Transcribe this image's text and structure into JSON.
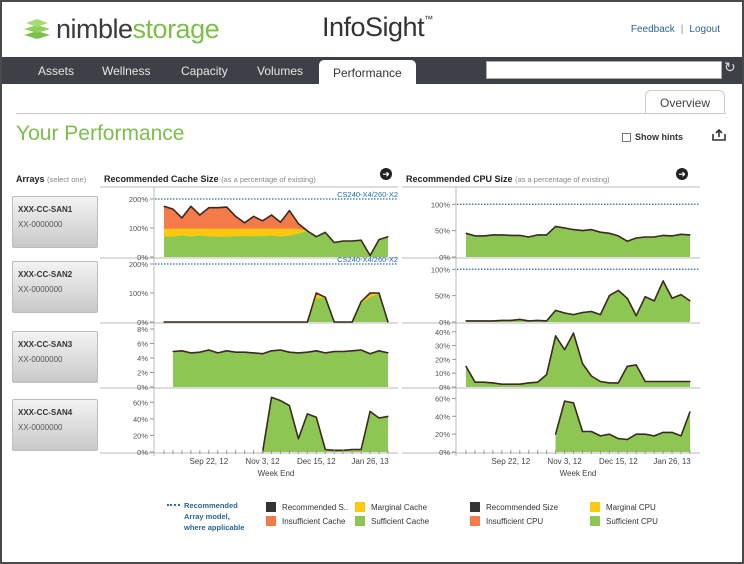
{
  "header": {
    "logo_part1": "nimble",
    "logo_part2": "storage",
    "app_title": "InfoSight",
    "trademark": "™",
    "links": [
      {
        "label": "Feedback"
      },
      {
        "label": "Logout"
      }
    ],
    "link_separator": "|"
  },
  "nav": {
    "tabs": [
      {
        "label": "Assets",
        "active": false
      },
      {
        "label": "Wellness",
        "active": false
      },
      {
        "label": "Capacity",
        "active": false
      },
      {
        "label": "Volumes",
        "active": false
      },
      {
        "label": "Performance",
        "active": true
      }
    ],
    "search": {
      "value": "",
      "placeholder": ""
    },
    "refresh_icon": "refresh-icon"
  },
  "subtabs": {
    "overview_label": "Overview"
  },
  "page": {
    "title": "Your Performance",
    "show_hints_label": "Show hints",
    "show_hints_checked": false,
    "export_icon": "export-icon"
  },
  "arrays": {
    "heading": "Arrays",
    "heading_sub": "(select one)",
    "items": [
      {
        "name": "XXX-CC-SAN1",
        "serial": "XX-0000000"
      },
      {
        "name": "XXX-CC-SAN2",
        "serial": "XX-0000000"
      },
      {
        "name": "XXX-CC-SAN3",
        "serial": "XX-0000000"
      },
      {
        "name": "XXX-CC-SAN4",
        "serial": "XX-0000000"
      }
    ]
  },
  "colors": {
    "sufficient": "#8dc653",
    "marginal": "#fdc80f",
    "insufficient": "#f47a4a",
    "recommended_line": "#3a2a20",
    "recommended_model": "#2a6eb0",
    "brand_green": "#7cc04a",
    "nav_bg": "#3d4046"
  },
  "legend": {
    "recommended_note": [
      "Recommended",
      "Array model,",
      "where applicable"
    ],
    "cache": [
      {
        "label": "Recommended S..",
        "color": "#333333"
      },
      {
        "label": "Marginal Cache",
        "color": "#fdc80f"
      },
      {
        "label": "Insufficient Cache",
        "color": "#f47a4a"
      },
      {
        "label": "Sufficient Cache",
        "color": "#8dc653"
      }
    ],
    "cpu": [
      {
        "label": "Recommended Size",
        "color": "#333333"
      },
      {
        "label": "Marginal CPU",
        "color": "#fdc80f"
      },
      {
        "label": "Insufficient CPU",
        "color": "#f47a4a"
      },
      {
        "label": "Sufficient CPU",
        "color": "#8dc653"
      }
    ]
  },
  "chart_data": [
    {
      "type": "area",
      "title": "Recommended Cache Size",
      "subtitle": "(as a percentage of existing)",
      "xlabel": "Week End",
      "x_ticks": [
        "Sep 22, 12",
        "Nov 3, 12",
        "Dec 15, 12",
        "Jan 26, 13"
      ],
      "x_tick_indices": [
        5,
        11,
        17,
        23
      ],
      "num_weeks": 26,
      "rows": [
        {
          "array": "XXX-CC-SAN1",
          "ylim": [
            0,
            200
          ],
          "yticks": [
            "0%",
            "100%",
            "200%"
          ],
          "ytick_values": [
            0,
            100,
            200
          ],
          "recommended_model": {
            "label": "CS240-X4/260-X2",
            "value": 200
          },
          "series": [
            {
              "name": "Recommended Size",
              "values": [
                175,
                165,
                135,
                175,
                145,
                170,
                170,
                172,
                140,
                118,
                140,
                125,
                145,
                120,
                160,
                115,
                90,
                70,
                85,
                50,
                55,
                55,
                58,
                5,
                60,
                70
              ]
            },
            {
              "name": "Marginal",
              "values": [
                98,
                98,
                98,
                98,
                98,
                98,
                98,
                98,
                98,
                98,
                98,
                98,
                98,
                98,
                98,
                98,
                90,
                70,
                85,
                50,
                55,
                55,
                58,
                5,
                60,
                70
              ]
            },
            {
              "name": "Sufficient",
              "values": [
                70,
                70,
                75,
                70,
                74,
                71,
                70,
                70,
                71,
                72,
                71,
                72,
                74,
                70,
                74,
                80,
                90,
                70,
                85,
                50,
                55,
                55,
                58,
                5,
                60,
                70
              ]
            }
          ]
        },
        {
          "array": "XXX-CC-SAN2",
          "ylim": [
            0,
            200
          ],
          "yticks": [
            "0%",
            "100%",
            "200%"
          ],
          "ytick_values": [
            0,
            100,
            200
          ],
          "recommended_model": {
            "label": "CS240-X4/260-X2",
            "value": 200
          },
          "series": [
            {
              "name": "Recommended Size",
              "values": [
                0,
                0,
                0,
                0,
                0,
                0,
                0,
                0,
                0,
                0,
                0,
                0,
                0,
                0,
                0,
                0,
                0,
                100,
                85,
                0,
                0,
                0,
                70,
                100,
                100,
                0
              ]
            },
            {
              "name": "Marginal",
              "values": [
                0,
                0,
                0,
                0,
                0,
                0,
                0,
                0,
                0,
                0,
                0,
                0,
                0,
                0,
                0,
                0,
                0,
                95,
                85,
                0,
                0,
                0,
                68,
                95,
                100,
                0
              ]
            },
            {
              "name": "Sufficient",
              "values": [
                0,
                0,
                0,
                0,
                0,
                0,
                0,
                0,
                0,
                0,
                0,
                0,
                0,
                0,
                0,
                0,
                0,
                80,
                85,
                0,
                0,
                0,
                65,
                85,
                98,
                0
              ]
            }
          ]
        },
        {
          "array": "XXX-CC-SAN3",
          "ylim": [
            0,
            8
          ],
          "yticks": [
            "0%",
            "2%",
            "4%",
            "6%",
            "8%"
          ],
          "ytick_values": [
            0,
            2,
            4,
            6,
            8
          ],
          "series": [
            {
              "name": "Recommended Size",
              "values": [
                null,
                4.9,
                5,
                4.7,
                4.8,
                5.1,
                4.7,
                5,
                4.8,
                4.8,
                4.7,
                4.6,
                5,
                5.1,
                4.8,
                4.7,
                4.8,
                5,
                4.7,
                4.9,
                4.9,
                5,
                5.1,
                4.6,
                5,
                4.7
              ]
            },
            {
              "name": "Sufficient",
              "values": [
                null,
                4.9,
                5,
                4.7,
                4.8,
                5.1,
                4.7,
                5,
                4.8,
                4.8,
                4.7,
                4.6,
                5,
                5.1,
                4.8,
                4.7,
                4.8,
                5,
                4.7,
                4.9,
                4.9,
                5,
                5.1,
                4.6,
                5,
                4.7
              ]
            }
          ]
        },
        {
          "array": "XXX-CC-SAN4",
          "ylim": [
            0,
            70
          ],
          "yticks": [
            "0%",
            "20%",
            "40%",
            "60%"
          ],
          "ytick_values": [
            0,
            20,
            40,
            60
          ],
          "series": [
            {
              "name": "Recommended Size",
              "values": [
                null,
                null,
                null,
                null,
                null,
                null,
                null,
                null,
                null,
                null,
                null,
                0,
                66,
                62,
                56,
                16,
                46,
                42,
                3,
                2,
                2,
                3,
                3,
                49,
                41,
                43
              ]
            },
            {
              "name": "Sufficient",
              "values": [
                null,
                null,
                null,
                null,
                null,
                null,
                null,
                null,
                null,
                null,
                null,
                0,
                66,
                62,
                56,
                16,
                46,
                42,
                3,
                2,
                2,
                3,
                3,
                49,
                41,
                43
              ]
            }
          ]
        }
      ]
    },
    {
      "type": "area",
      "title": "Recommended CPU Size",
      "subtitle": "(as a percentage of existing)",
      "xlabel": "Week End",
      "x_ticks": [
        "Sep 22, 12",
        "Nov 3, 12",
        "Dec 15, 12",
        "Jan 26, 13"
      ],
      "x_tick_indices": [
        5,
        11,
        17,
        23
      ],
      "num_weeks": 26,
      "rows": [
        {
          "array": "XXX-CC-SAN1",
          "ylim": [
            0,
            110
          ],
          "yticks": [
            "0%",
            "50%",
            "100%"
          ],
          "ytick_values": [
            0,
            50,
            100
          ],
          "recommended_model": {
            "label": "",
            "value": 100
          },
          "series": [
            {
              "name": "Recommended Size",
              "values": [
                45,
                40,
                40,
                42,
                42,
                41,
                41,
                38,
                42,
                42,
                58,
                55,
                52,
                50,
                52,
                47,
                45,
                40,
                30,
                36,
                38,
                38,
                41,
                40,
                43,
                42
              ]
            },
            {
              "name": "Sufficient",
              "values": [
                45,
                40,
                40,
                42,
                42,
                41,
                41,
                38,
                42,
                42,
                58,
                55,
                52,
                50,
                52,
                47,
                45,
                40,
                30,
                36,
                38,
                38,
                41,
                40,
                43,
                42
              ]
            }
          ]
        },
        {
          "array": "XXX-CC-SAN2",
          "ylim": [
            0,
            110
          ],
          "yticks": [
            "0%",
            "50%",
            "100%"
          ],
          "ytick_values": [
            0,
            50,
            100
          ],
          "recommended_model": {
            "label": "",
            "value": 100
          },
          "series": [
            {
              "name": "Recommended Size",
              "values": [
                2,
                2,
                2,
                2,
                3,
                3,
                5,
                2,
                3,
                2,
                22,
                17,
                14,
                18,
                20,
                14,
                50,
                60,
                45,
                12,
                48,
                40,
                78,
                45,
                52,
                40
              ]
            },
            {
              "name": "Sufficient",
              "values": [
                2,
                2,
                2,
                2,
                3,
                3,
                5,
                2,
                3,
                2,
                22,
                17,
                14,
                18,
                20,
                14,
                50,
                60,
                45,
                12,
                48,
                40,
                78,
                45,
                52,
                40
              ]
            }
          ]
        },
        {
          "array": "XXX-CC-SAN3",
          "ylim": [
            0,
            42
          ],
          "yticks": [
            "0%",
            "10%",
            "20%",
            "30%",
            "40%"
          ],
          "ytick_values": [
            0,
            10,
            20,
            30,
            40
          ],
          "series": [
            {
              "name": "Recommended Size",
              "values": [
                15,
                3.5,
                3.5,
                3,
                2,
                2,
                2,
                3,
                3.5,
                9,
                37,
                27,
                39,
                17,
                8,
                4,
                3,
                3,
                15,
                16,
                4,
                4,
                4,
                4,
                4,
                4
              ]
            },
            {
              "name": "Sufficient",
              "values": [
                15,
                3.5,
                3.5,
                3,
                2,
                2,
                2,
                3,
                3.5,
                9,
                37,
                27,
                39,
                17,
                8,
                4,
                3,
                3,
                15,
                16,
                4,
                4,
                4,
                4,
                4,
                4
              ]
            }
          ]
        },
        {
          "array": "XXX-CC-SAN4",
          "ylim": [
            0,
            65
          ],
          "yticks": [
            "0%",
            "20%",
            "40%",
            "60%"
          ],
          "ytick_values": [
            0,
            20,
            40,
            60
          ],
          "series": [
            {
              "name": "Recommended Size",
              "values": [
                null,
                null,
                null,
                null,
                null,
                null,
                null,
                null,
                null,
                null,
                20,
                57,
                55,
                23,
                23,
                18,
                20,
                15,
                14,
                20,
                20,
                18,
                22,
                22,
                18,
                45
              ]
            },
            {
              "name": "Sufficient",
              "values": [
                null,
                null,
                null,
                null,
                null,
                null,
                null,
                null,
                null,
                null,
                20,
                57,
                55,
                23,
                23,
                18,
                20,
                15,
                14,
                20,
                20,
                18,
                22,
                22,
                18,
                45
              ]
            }
          ]
        }
      ]
    }
  ]
}
